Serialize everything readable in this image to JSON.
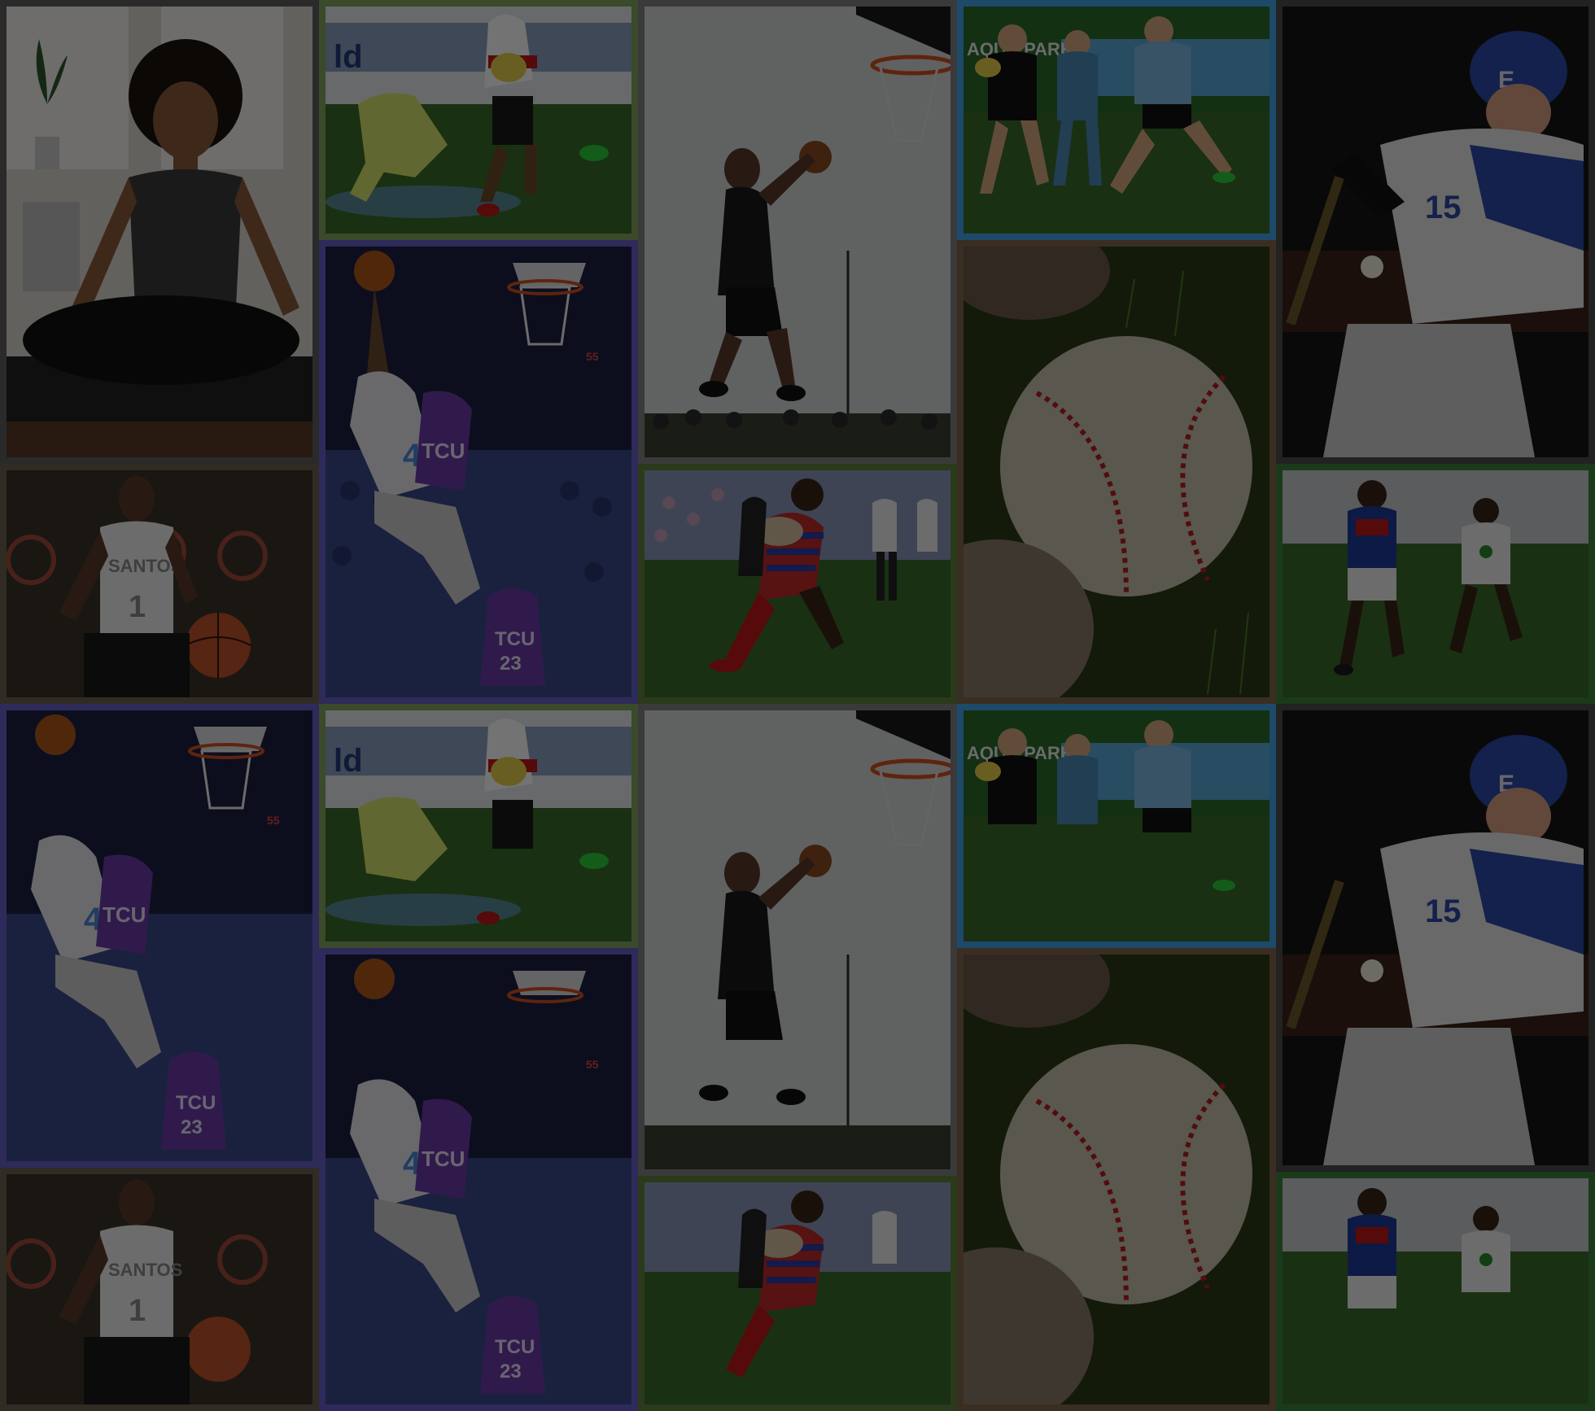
{
  "collage": {
    "overlay_color": "#000000",
    "background_color": "#15151a",
    "scenes": {
      "meditation": {
        "palette": [
          "#e8e4de",
          "#3a3a3a",
          "#2a1a12",
          "#1a1a1a"
        ]
      },
      "rugby_green": {
        "palette": [
          "#3d6a2a",
          "#ffffff",
          "#1f8a2a",
          "#c21818"
        ]
      },
      "basketball_dunk_tcu": {
        "palette": [
          "#1e2346",
          "#e6e6f0",
          "#5b2a9a",
          "#b05a1a"
        ],
        "text_tcu": "TCU",
        "text_number": "23",
        "text_4": "4",
        "scoreboard": "55"
      },
      "basketball_outdoor": {
        "palette": [
          "#d8dcdc",
          "#1a1a1a",
          "#b34a1a",
          "#2a3a2a"
        ]
      },
      "rugby_blue": {
        "palette": [
          "#3a7a2a",
          "#6fb1d8",
          "#111111",
          "#f0f0f0"
        ],
        "sponsor": "AQUA PARK"
      },
      "baseball_ball": {
        "palette": [
          "#2f4a1a",
          "#c9c2b2",
          "#b41e1e",
          "#5a4a3a"
        ]
      },
      "baseball_batter": {
        "palette": [
          "#1a1a1a",
          "#2a4aa8",
          "#e8e8e8",
          "#a8a8a8"
        ],
        "helmet_letter": "E",
        "jersey_number": "15"
      },
      "basketball_player_studio": {
        "palette": [
          "#2a2824",
          "#f2f2f2",
          "#c0522a",
          "#1a1a1a"
        ],
        "jersey_text": "SANTOS",
        "jersey_number": "1"
      },
      "rugby_tackle": {
        "palette": [
          "#2a5a1a",
          "#c21818",
          "#1e3a8a",
          "#1a1a1a"
        ]
      },
      "rugby_running": {
        "palette": [
          "#3a6a2a",
          "#1e3a9a",
          "#f0f0f0",
          "#c21818"
        ]
      }
    }
  }
}
